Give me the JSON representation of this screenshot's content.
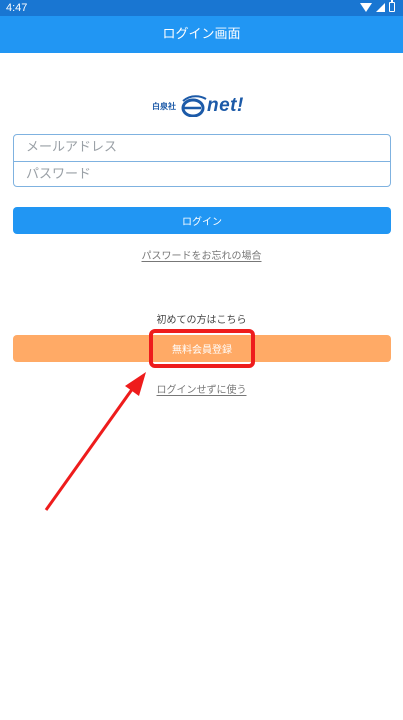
{
  "status_bar": {
    "time": "4:47"
  },
  "app_bar": {
    "title": "ログイン画面"
  },
  "logo": {
    "small_text": "白泉社",
    "net_text": "net!"
  },
  "form": {
    "email_placeholder": "メールアドレス",
    "password_placeholder": "パスワード"
  },
  "actions": {
    "login_label": "ログイン",
    "forgot_password_label": "パスワードをお忘れの場合",
    "first_time_text": "初めての方はこちら",
    "register_label": "無料会員登録",
    "guest_label": "ログインせずに使う"
  },
  "colors": {
    "app_bar": "#2196f3",
    "status_bar": "#1976d2",
    "register": "#ffaa66",
    "annotation": "#ee1c1c"
  }
}
